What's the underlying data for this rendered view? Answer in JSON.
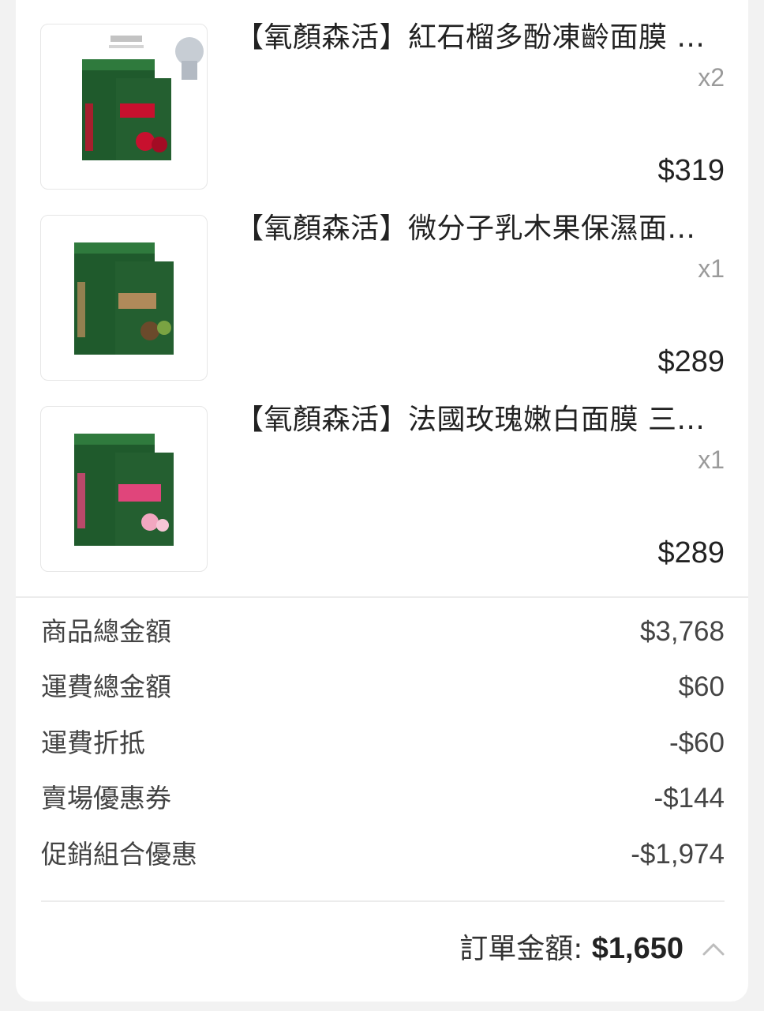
{
  "products": [
    {
      "title": "【氧顏森活】紅石榴多酚凍齡面膜 ...",
      "qty": "x2",
      "price": "$319",
      "accent": "#c8102e"
    },
    {
      "title": "【氧顏森活】微分子乳木果保濕面...",
      "qty": "x1",
      "price": "$289",
      "accent": "#b08a5a"
    },
    {
      "title": "【氧顏森活】法國玫瑰嫩白面膜 三...",
      "qty": "x1",
      "price": "$289",
      "accent": "#e0457b"
    }
  ],
  "summary": [
    {
      "label": "商品總金額",
      "value": "$3,768"
    },
    {
      "label": "運費總金額",
      "value": "$60"
    },
    {
      "label": "運費折抵",
      "value": "-$60"
    },
    {
      "label": "賣場優惠券",
      "value": "-$144"
    },
    {
      "label": "促銷組合優惠",
      "value": "-$1,974"
    }
  ],
  "total": {
    "label": "訂單金額: ",
    "amount": "$1,650"
  },
  "icons": {
    "toggle": "chevron-up-icon"
  },
  "colors": {
    "brand_green": "#1f5a2c",
    "text_muted": "#9a9a9a"
  }
}
